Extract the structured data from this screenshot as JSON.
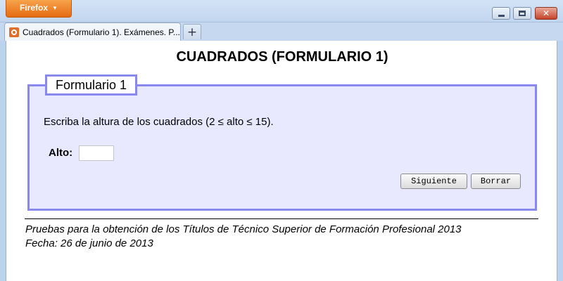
{
  "browser": {
    "menu_label": "Firefox",
    "tab_title": "Cuadrados (Formulario 1). Exámenes. P...",
    "new_tab_label": "+",
    "close_label": "✕"
  },
  "page": {
    "title": "CUADRADOS (FORMULARIO 1)",
    "legend": "Formulario 1",
    "instruction": "Escriba la altura de los cuadrados (2 ≤ alto ≤ 15).",
    "alto_label": "Alto:",
    "alto_value": "",
    "next_button": "Siguiente",
    "clear_button": "Borrar",
    "footer_line1": "Pruebas para la obtención de los Títulos de Técnico Superior de Formación Profesional 2013",
    "footer_line2": "Fecha: 26 de junio de 2013"
  },
  "colors": {
    "fieldset_border": "#8888ee",
    "fieldset_background": "#e8e8ff",
    "firefox_button": "#e66a12"
  }
}
